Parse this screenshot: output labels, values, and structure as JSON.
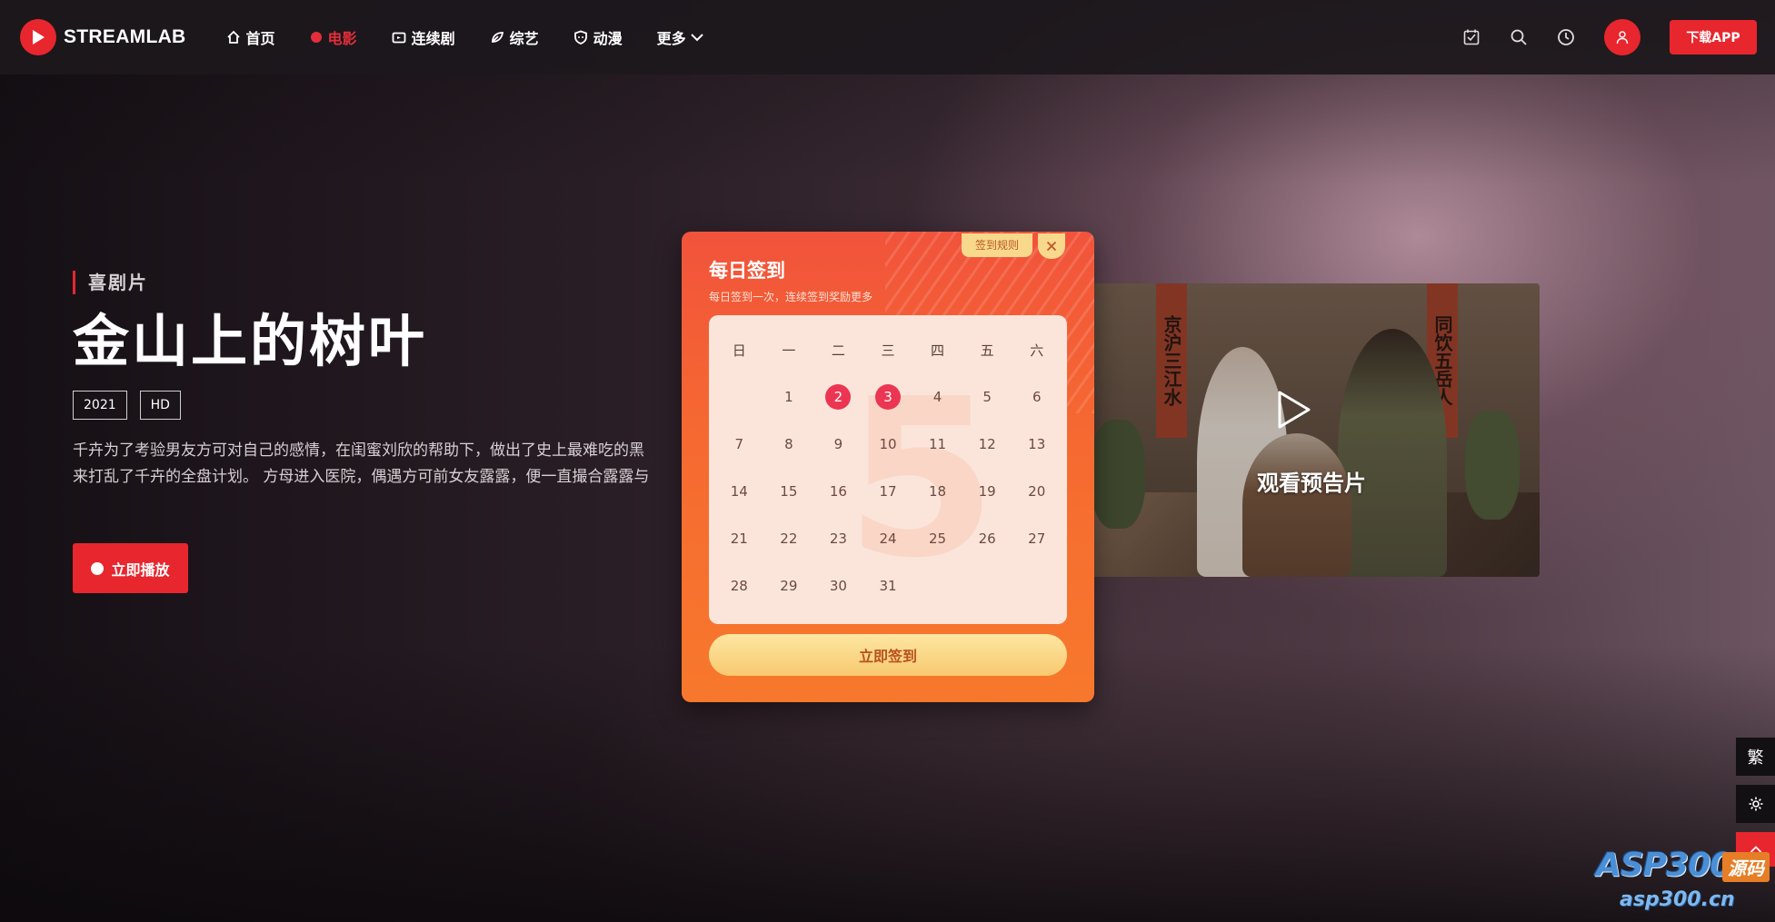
{
  "nav": {
    "logo_text": "STREAMLAB",
    "items": [
      {
        "label": "首页",
        "icon": "home-icon",
        "active": false
      },
      {
        "label": "电影",
        "icon": "dot-icon",
        "active": true
      },
      {
        "label": "连续剧",
        "icon": "tv-icon",
        "active": false
      },
      {
        "label": "综艺",
        "icon": "leaf-icon",
        "active": false
      },
      {
        "label": "动漫",
        "icon": "shield-icon",
        "active": false
      },
      {
        "label": "更多",
        "icon": "chevron-down-icon",
        "active": false
      }
    ],
    "right_icons": [
      "checkin-icon",
      "search-icon",
      "history-icon",
      "user-icon"
    ],
    "download_label": "下载APP"
  },
  "hero": {
    "genre": "喜剧片",
    "title": "金山上的树叶",
    "tags": [
      "2021",
      "HD"
    ],
    "synopsis_lines": [
      "千卉为了考验男友方可对自己的感情，在闺蜜刘欣的帮助下，做出了史上最难吃的黑",
      "来打乱了千卉的全盘计划。 方母进入医院，偶遇方可前女友露露，便一直撮合露露与"
    ],
    "play_label": "立即播放"
  },
  "trailer": {
    "label": "观看预告片",
    "banner_left": "京沪三江水",
    "banner_right": "同饮五岳人"
  },
  "checkin": {
    "title": "每日签到",
    "subtitle": "每日签到一次，连续签到奖励更多",
    "rules_label": "签到规则",
    "background_number": "5",
    "weekdays": [
      "日",
      "一",
      "二",
      "三",
      "四",
      "五",
      "六"
    ],
    "month_start_weekday": 1,
    "days_in_month": 31,
    "checked_days": [
      2,
      3
    ],
    "button_label": "立即签到"
  },
  "side_tools": {
    "traditional_label": "繁",
    "settings_icon": "gear-icon",
    "up_icon": "chevron-up-icon"
  },
  "watermark": {
    "main": "ASP300",
    "badge": "源码",
    "sub": "asp300.cn"
  },
  "colors": {
    "accent": "#e8262e",
    "modal_top": "#f1533b",
    "modal_bottom": "#f7782c",
    "checked_day": "#ec3552"
  }
}
